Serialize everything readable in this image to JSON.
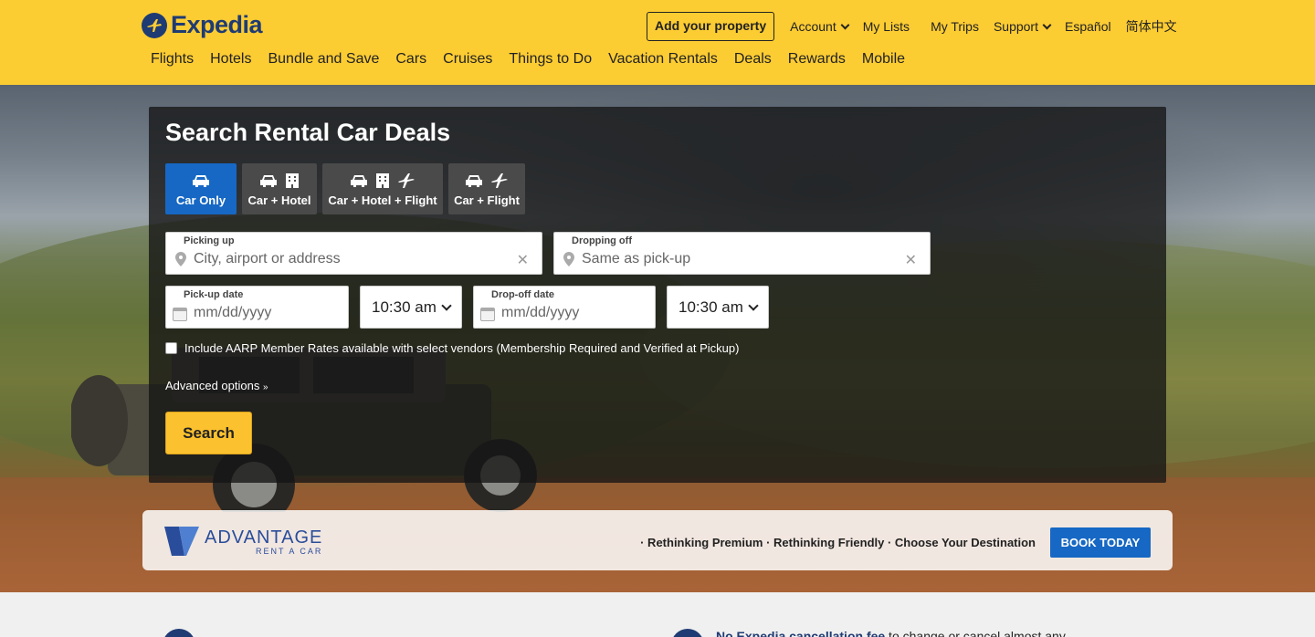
{
  "header": {
    "logo_text": "Expedia",
    "add_property": "Add your property",
    "top_links": {
      "account": "Account",
      "my_lists": "My Lists",
      "my_trips": "My Trips",
      "support": "Support",
      "espanol": "Español",
      "chinese": "简体中文"
    },
    "nav": [
      "Flights",
      "Hotels",
      "Bundle and Save",
      "Cars",
      "Cruises",
      "Things to Do",
      "Vacation Rentals",
      "Deals",
      "Rewards",
      "Mobile"
    ]
  },
  "search": {
    "title": "Search Rental Car Deals",
    "tabs": [
      "Car Only",
      "Car + Hotel",
      "Car + Hotel + Flight",
      "Car + Flight"
    ],
    "picking_up_label": "Picking up",
    "picking_up_placeholder": "City, airport or address",
    "dropping_off_label": "Dropping off",
    "dropping_off_placeholder": "Same as pick-up",
    "pickup_date_label": "Pick-up date",
    "pickup_date_placeholder": "mm/dd/yyyy",
    "pickup_time": "10:30 am",
    "dropoff_date_label": "Drop-off date",
    "dropoff_date_placeholder": "mm/dd/yyyy",
    "dropoff_time": "10:30 am",
    "aarp_text": "Include AARP Member Rates available with select vendors (Membership Required and Verified at Pickup)",
    "advanced_options": "Advanced options",
    "search_button": "Search"
  },
  "banner": {
    "brand": "ADVANTAGE",
    "brand_sub": "RENT A CAR",
    "tagline": "· Rethinking Premium · Rethinking Friendly · Choose Your Destination",
    "cta": "BOOK TODAY"
  },
  "bottom": {
    "feature_bold": "No Expedia cancellation fee",
    "feature_rest": " to change or cancel almost any"
  },
  "colors": {
    "header_bg": "#fccc33",
    "active_tab": "#1668c4",
    "search_button": "#fcc12e",
    "brand_navy": "#1f3b73"
  }
}
